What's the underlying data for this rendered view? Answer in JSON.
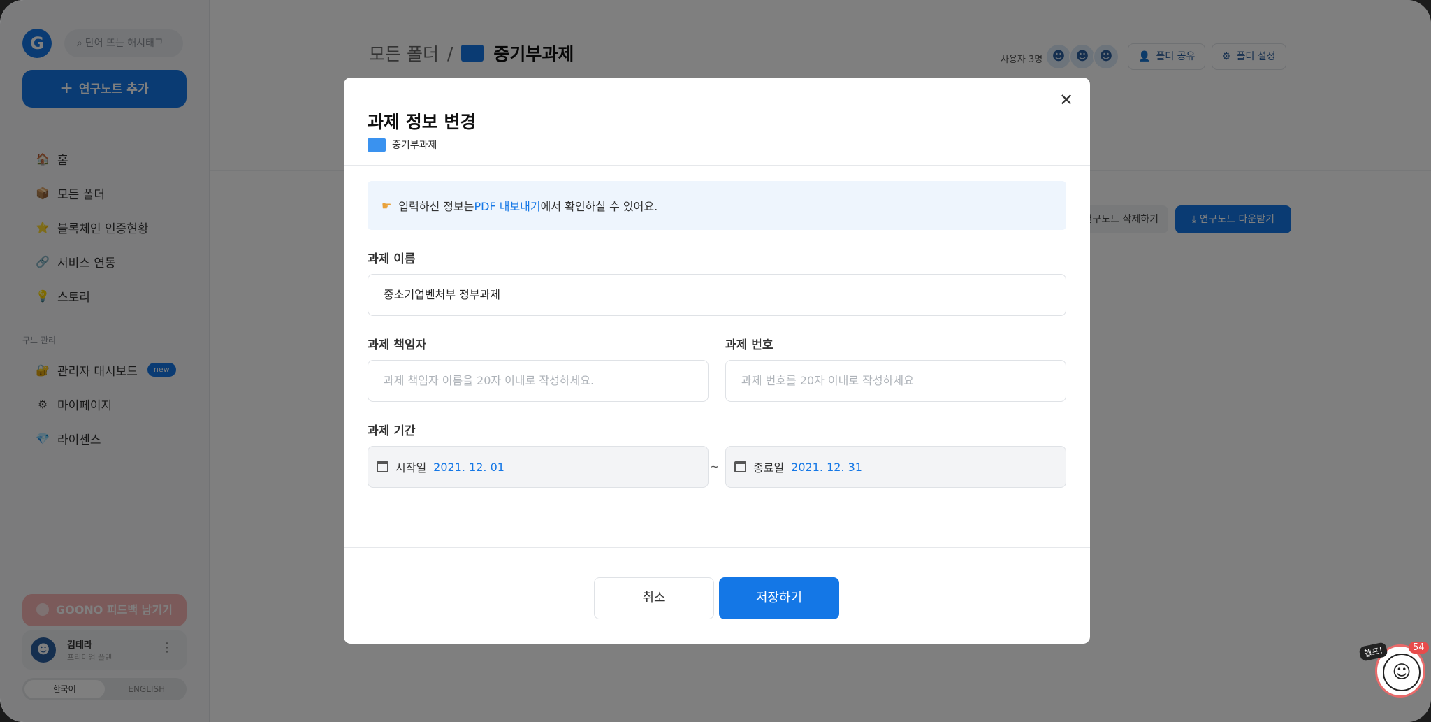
{
  "sidebar": {
    "logo": "G",
    "search_placeholder": "단어 뜨는 해시태그",
    "add_note_label": "연구노트 추가",
    "nav": [
      {
        "icon": "🏠",
        "label": "홈"
      },
      {
        "icon": "📦",
        "label": "모든 폴더"
      },
      {
        "icon": "⭐",
        "label": "블록체인 인증현황"
      },
      {
        "icon": "🔗",
        "label": "서비스 연동"
      },
      {
        "icon": "💡",
        "label": "스토리"
      }
    ],
    "section_label": "구노 관리",
    "admin_nav": [
      {
        "icon": "🔐",
        "label": "관리자 대시보드",
        "badge": "new"
      },
      {
        "icon": "⚙",
        "label": "마이페이지"
      },
      {
        "icon": "💎",
        "label": "라이센스"
      }
    ],
    "feedback_label": "GOONO 피드백 남기기",
    "user": {
      "name": "김테라",
      "plan": "프리미엄 플랜"
    },
    "lang": {
      "ko": "한국어",
      "en": "ENGLISH"
    }
  },
  "header": {
    "breadcrumb_root": "모든 폴더",
    "breadcrumb_sep": "/",
    "breadcrumb_current": "중기부과제",
    "users_count_label": "사용자 3명",
    "share_label": "폴더 공유",
    "settings_label": "폴더 설정",
    "delete_label": "연구노트 삭제하기",
    "download_label": "연구노트 다운받기"
  },
  "modal": {
    "title": "과제 정보 변경",
    "folder_name": "중기부과제",
    "info": {
      "prefix": "입력하신 정보는 ",
      "link": "PDF 내보내기",
      "suffix": "에서 확인하실 수 있어요."
    },
    "name_label": "과제 이름",
    "name_value": "중소기업벤처부 정부과제",
    "manager_label": "과제 책임자",
    "manager_placeholder": "과제 책임자 이름을 20자 이내로 작성하세요.",
    "number_label": "과제 번호",
    "number_placeholder": "과제 번호를 20자 이내로 작성하세요",
    "period_label": "과제 기간",
    "start_label": "시작일",
    "start_value": "2021. 12. 01",
    "tilde": "~",
    "end_label": "종료일",
    "end_value": "2021. 12. 31",
    "cancel_label": "취소",
    "save_label": "저장하기"
  },
  "help": {
    "tag": "헬프!",
    "badge": "54"
  }
}
